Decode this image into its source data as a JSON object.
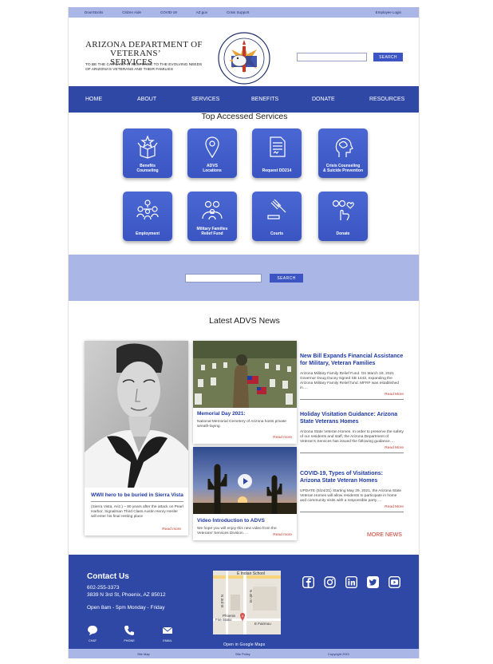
{
  "topbar": {
    "links": [
      "DoorStocks",
      "Citizen Aide",
      "COVID-19",
      "AZ.gov",
      "Crisis Support"
    ],
    "employee_login": "Employee Login"
  },
  "header": {
    "org_line1": "Arizona Department of",
    "org_line2": "Veterans’ Services",
    "tagline": "To be the catalyst in response to the evolving needs of Arizona’s veterans and their families",
    "search_placeholder": "",
    "search_button": "SEARCH"
  },
  "nav": [
    "HOME",
    "ABOUT",
    "SERVICES",
    "BENEFITS",
    "DONATE",
    "RESOURCES"
  ],
  "services": {
    "title": "Top Accessed Services",
    "tiles": [
      {
        "line1": "Benefits",
        "line2": "Counseling",
        "icon": "box-star-icon"
      },
      {
        "line1": "ADVS",
        "line2": "Locations",
        "icon": "location-pin-icon"
      },
      {
        "line1": "Request DD214",
        "line2": "",
        "icon": "document-icon"
      },
      {
        "line1": "Crisis Counseling",
        "line2": "& Suicide Prevention",
        "icon": "head-brain-icon"
      },
      {
        "line1": "Employment",
        "line2": "",
        "icon": "people-network-icon"
      },
      {
        "line1": "Military Families",
        "line2": "Relief Fund",
        "icon": "family-icon"
      },
      {
        "line1": "Courts",
        "line2": "",
        "icon": "gavel-icon"
      },
      {
        "line1": "Donate",
        "line2": "",
        "icon": "hand-heart-icon"
      }
    ]
  },
  "band_search": {
    "placeholder": "",
    "button": "SEARCH"
  },
  "news": {
    "title": "Latest  ADVS News",
    "feature": {
      "title": "WWII hero to be buried in Sierra Vista",
      "text": "(Sierra Vista, Ariz.) – 80 years after the attack on Pearl Harbor, Signalman Third Class Austin Henry Hesler will enter his final resting place",
      "more": "Read more"
    },
    "memorial": {
      "title": "Memorial Day 2021:",
      "text": "National Memorial Cemetery of Arizona hosts private wreath-laying.",
      "more": "Read more"
    },
    "video": {
      "title": "Video Introduction to ADVS",
      "text": "We hope you will enjoy this new video from the Veterans’ Services Division….",
      "more": "Read more"
    },
    "side": [
      {
        "title": "New Bill Expands Financial Assistance for Military, Veteran Families",
        "text": "Arizona Military Family Relief Fund. On March 18, 2021 Governor Doug Ducey signed SB 1443, expanding the Arizona Military Family Relief fund. MFRF was established in….",
        "more": "Read More"
      },
      {
        "title": "Holiday Visitation Guidance: Arizona State Veterans Homes",
        "text": "Arizona State Veteran Homes. In order to preserve the safety of our residents and staff, the Arizona Department of Veteran’s Services has issued the following guidance….",
        "more": "Read More"
      },
      {
        "title": "COVID-19, Types of Visitations: Arizona State Veteran Homes",
        "text": "UPDATE (5/24/21) Starting May 29, 2021, the Arizona State Veteran Homes will allow residents to participate in home and community visits with a responsible party….",
        "more": "Read More"
      }
    ],
    "more_news": "MORE NEWS"
  },
  "footer": {
    "title": "Contact Us",
    "phone": "602-255-3373",
    "address": "3839 N 3rd St, Phoenix, AZ 85012",
    "hours": "Open 8am - 5pm Monday - Friday",
    "chat": "CHAT",
    "phone_label": "PHONE",
    "email": "EMAIL",
    "map_link": "Open in Google Maps",
    "map_labels": {
      "top": "E Indian School",
      "left": "N 3rd St",
      "mid": "N 4th St",
      "place1": "Phoenix",
      "place2": "Fire Statio",
      "marker": "A",
      "right": "E Fairmou"
    }
  },
  "bottombar": {
    "sitemap": "Site Map",
    "policy": "Site Policy",
    "copyright": "Copyright 2021"
  },
  "colors": {
    "primary": "#2f48a6",
    "light": "#a9b6e6",
    "accent_red": "#c0392b",
    "tile": "#3f5bcb"
  }
}
